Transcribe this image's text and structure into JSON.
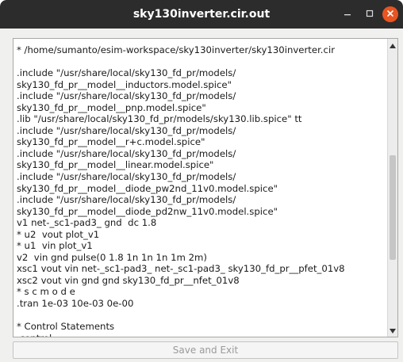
{
  "window": {
    "title": "sky130inverter.cir.out"
  },
  "editor": {
    "lines": [
      "* /home/sumanto/esim-workspace/sky130inverter/sky130inverter.cir",
      "",
      ".include \"/usr/share/local/sky130_fd_pr/models/",
      "sky130_fd_pr__model__inductors.model.spice\"",
      ".include \"/usr/share/local/sky130_fd_pr/models/",
      "sky130_fd_pr__model__pnp.model.spice\"",
      ".lib \"/usr/share/local/sky130_fd_pr/models/sky130.lib.spice\" tt",
      ".include \"/usr/share/local/sky130_fd_pr/models/",
      "sky130_fd_pr__model__r+c.model.spice\"",
      ".include \"/usr/share/local/sky130_fd_pr/models/",
      "sky130_fd_pr__model__linear.model.spice\"",
      ".include \"/usr/share/local/sky130_fd_pr/models/",
      "sky130_fd_pr__model__diode_pw2nd_11v0.model.spice\"",
      ".include \"/usr/share/local/sky130_fd_pr/models/",
      "sky130_fd_pr__model__diode_pd2nw_11v0.model.spice\"",
      "v1 net-_sc1-pad3_ gnd  dc 1.8",
      "* u2  vout plot_v1",
      "* u1  vin plot_v1",
      "v2  vin gnd pulse(0 1.8 1n 1n 1n 1m 2m)",
      "xsc1 vout vin net-_sc1-pad3_ net-_sc1-pad3_ sky130_fd_pr__pfet_01v8",
      "xsc2 vout vin gnd gnd sky130_fd_pr__nfet_01v8",
      "* s c m o d e",
      ".tran 1e-03 10e-03 0e-00",
      "",
      "* Control Statements",
      ".control"
    ]
  },
  "scroll": {
    "position": 0.62
  },
  "buttons": {
    "save_exit": "Save and Exit"
  },
  "icons": {
    "minimize": "minimize-icon",
    "maximize": "maximize-icon",
    "close": "close-icon",
    "scroll_up": "arrow-up-icon",
    "scroll_down": "arrow-down-icon"
  },
  "colors": {
    "titlebar": "#2c2c2c",
    "close_button": "#e95420"
  }
}
